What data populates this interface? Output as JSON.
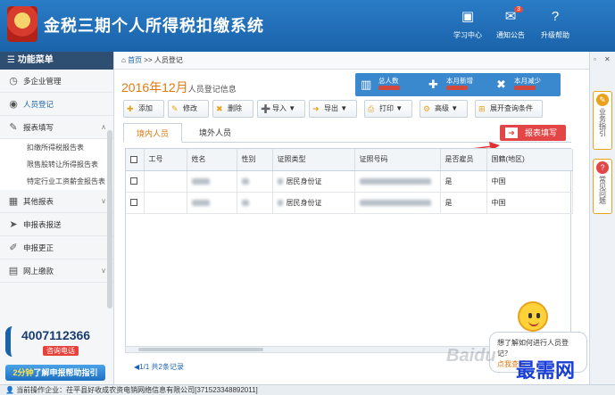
{
  "app": {
    "title": "金税三期个人所得税扣缴系统"
  },
  "header": {
    "buttons": [
      {
        "label": "学习中心",
        "icon": "study-icon"
      },
      {
        "label": "通知公告",
        "icon": "mail-icon",
        "badge": "3"
      },
      {
        "label": "升级帮助",
        "icon": "help-icon"
      }
    ]
  },
  "sidebar": {
    "title": "功能菜单",
    "items": [
      {
        "label": "多企业管理",
        "icon": "clock-icon"
      },
      {
        "label": "人员登记",
        "icon": "person-icon"
      },
      {
        "label": "报表填写",
        "icon": "edit-icon"
      },
      {
        "label": "其他报表",
        "icon": "grid-icon"
      },
      {
        "label": "申报表报送",
        "icon": "send-icon"
      },
      {
        "label": "申报更正",
        "icon": "pen-icon"
      },
      {
        "label": "网上缴款",
        "icon": "bank-icon"
      }
    ],
    "sub_items": [
      "扣缴所得税报告表",
      "限售股转让所得报告表",
      "特定行业工资薪金报告表"
    ],
    "hotline": "4007112366",
    "hotline_tag": "咨询电话",
    "guide_prefix": "2分钟",
    "guide_text": "了解申报帮助指引"
  },
  "main": {
    "breadcrumb_home": "首页",
    "breadcrumb_sep": ">>",
    "breadcrumb_page": "人员登记",
    "title_main": "2016年12月",
    "title_sub": "人员登记信息",
    "stats": [
      {
        "label": "总人数",
        "icon": "people-icon"
      },
      {
        "label": "本月新增",
        "icon": "add-person-icon"
      },
      {
        "label": "本月减少",
        "icon": "remove-person-icon"
      }
    ],
    "toolbar": [
      {
        "label": "添加"
      },
      {
        "label": "修改"
      },
      {
        "label": "删除"
      },
      {
        "label": "导入 ▼"
      },
      {
        "label": "导出 ▼"
      },
      {
        "label": "打印 ▼"
      },
      {
        "label": "高级 ▼"
      },
      {
        "label": "展开查询条件"
      }
    ],
    "tabs": [
      "境内人员",
      "境外人员"
    ],
    "report_button": "报表填写",
    "table": {
      "columns": [
        "工号",
        "姓名",
        "性别",
        "证照类型",
        "证照号码",
        "是否雇员",
        "国籍(地区)"
      ],
      "rows": [
        {
          "id_type": "居民身份证",
          "employee": "是",
          "nationality": "中国"
        },
        {
          "id_type": "居民身份证",
          "employee": "是",
          "nationality": "中国"
        }
      ]
    },
    "pager": "1/1 共2条记录"
  },
  "right_panel": {
    "tab1": "业务指引",
    "tab2": "常见问题"
  },
  "assistant": {
    "bubble_text": "想了解如何进行人员登记？",
    "bubble_link": "点我查看"
  },
  "watermarks": {
    "baidu": "Baidu",
    "site": "最需网"
  },
  "statusbar": {
    "company": "当前操作企业：茌平县好收成农资电销网络信息有限公司[371523348892011]"
  }
}
